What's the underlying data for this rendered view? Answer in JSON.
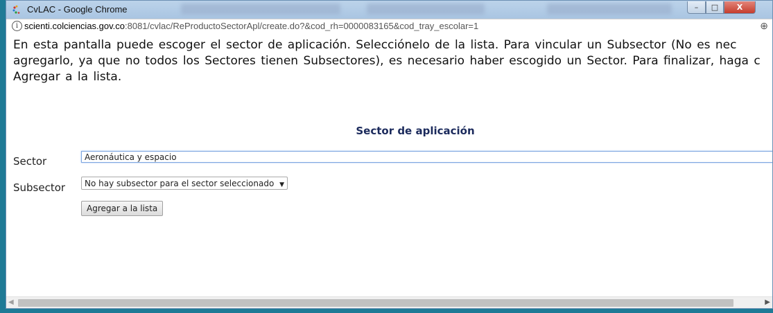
{
  "window": {
    "title": "CvLAC - Google Chrome",
    "controls": {
      "minimize": "–",
      "maximize": "□",
      "close": "X"
    }
  },
  "address": {
    "domain": "scienti.colciencias.gov.co",
    "path": ":8081/cvlac/ReProductoSectorApl/create.do?&cod_rh=0000083165&cod_tray_escolar=1",
    "info_icon": "info-icon",
    "zoom_icon": "zoom-icon"
  },
  "intro": {
    "line1": "En esta pantalla puede escoger el sector de aplicación. Selecciónelo de la lista. Para vincular un Subsector (No es nec",
    "line2": "agregarlo, ya que no todos los Sectores tienen Subsectores), es necesario haber escogido un Sector. Para finalizar, haga c",
    "line3": "Agregar a la lista."
  },
  "form": {
    "section_title": "Sector de aplicación",
    "sector_label": "Sector",
    "sector_value": "Aeronáutica y espacio",
    "subsector_label": "Subsector",
    "subsector_value": "No hay subsector para el sector seleccionado",
    "submit_label": "Agregar a la lista"
  }
}
